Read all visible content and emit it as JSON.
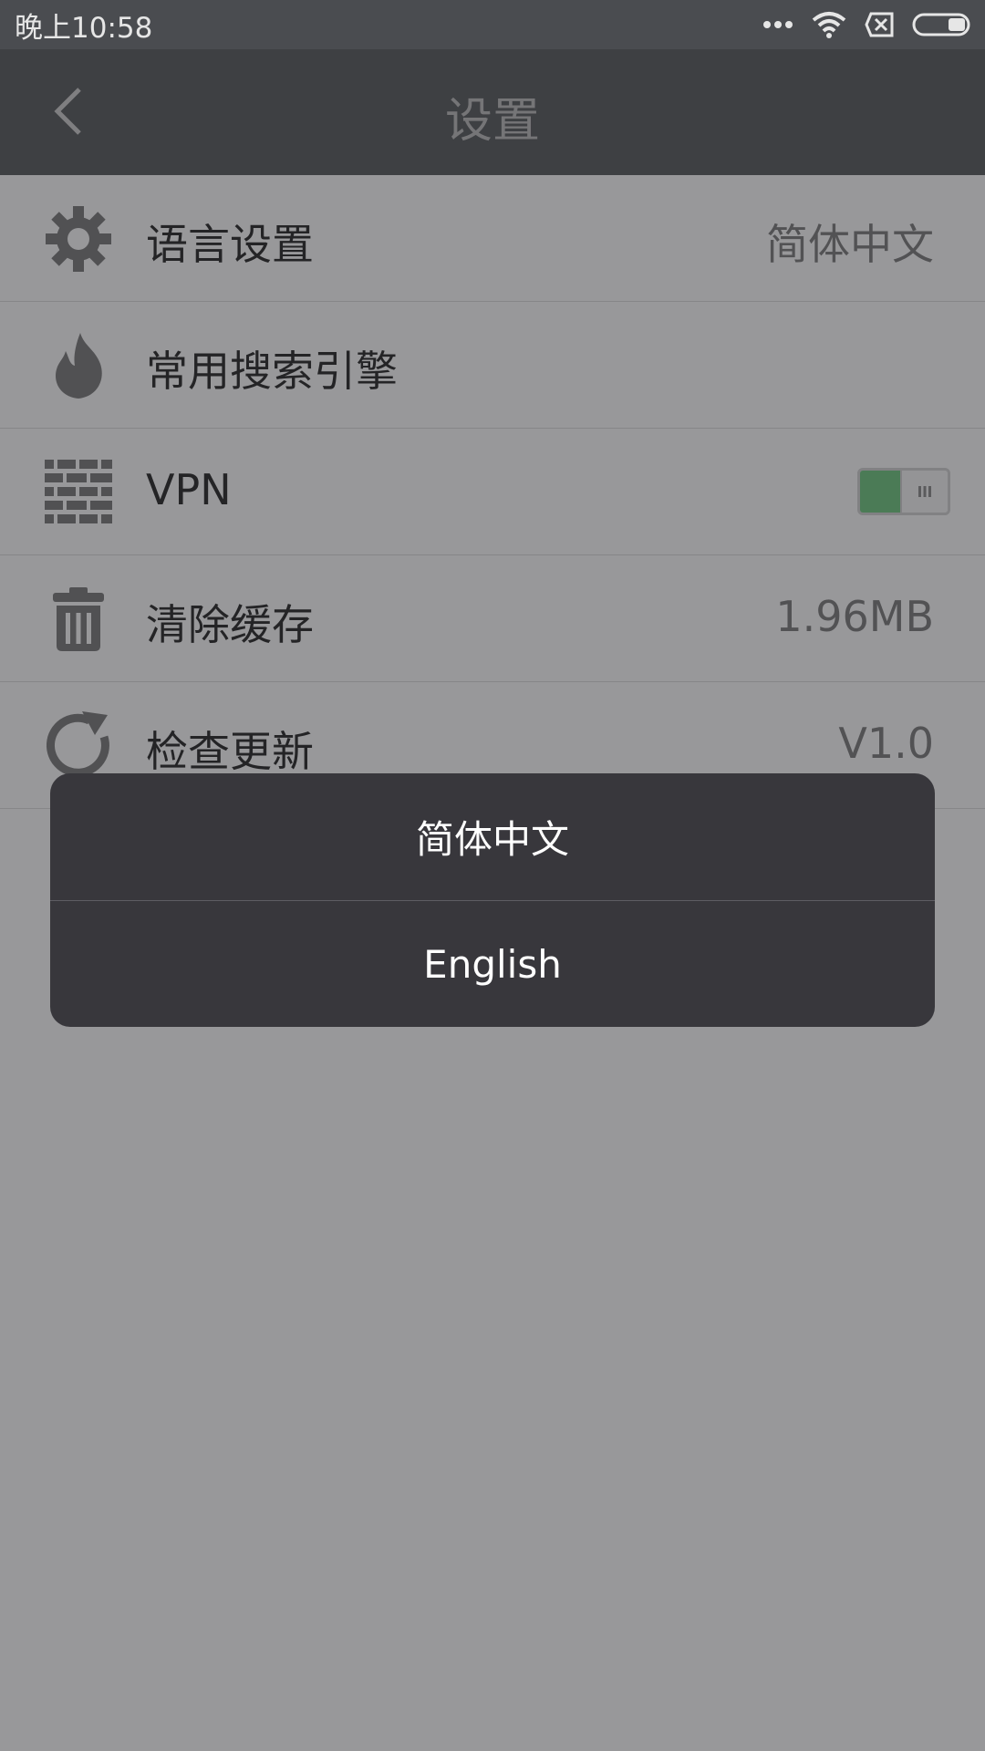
{
  "status_bar": {
    "time": "晚上10:58",
    "icons": [
      "more-dots-icon",
      "wifi-icon",
      "no-sim-icon",
      "battery-icon"
    ]
  },
  "app_bar": {
    "back_icon": "chevron-left-icon",
    "title": "设置"
  },
  "settings": {
    "items": [
      {
        "icon": "gear-icon",
        "label": "语言设置",
        "value": "简体中文"
      },
      {
        "icon": "flame-icon",
        "label": "常用搜索引擎",
        "value": ""
      },
      {
        "icon": "brick-wall-icon",
        "label": "VPN",
        "toggle_on": true
      },
      {
        "icon": "trash-icon",
        "label": "清除缓存",
        "value": "1.96MB"
      },
      {
        "icon": "refresh-icon",
        "label": "检查更新",
        "value": "V1.0"
      }
    ]
  },
  "language_dialog": {
    "options": [
      "简体中文",
      "English"
    ]
  },
  "colors": {
    "toggle_on": "#6cc77e",
    "dialog_bg": "#38373c",
    "app_bar": "#545659"
  }
}
